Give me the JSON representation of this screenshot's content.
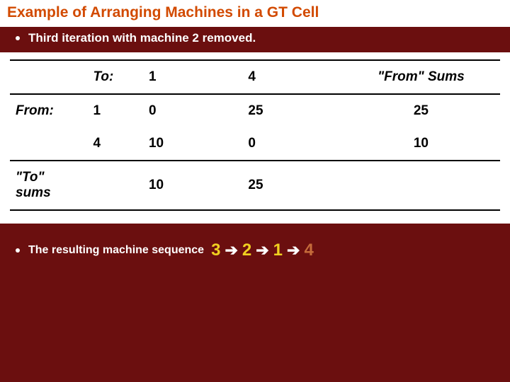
{
  "title": "Example of Arranging Machines in a GT Cell",
  "bullets": {
    "iteration": "Third iteration with machine 2 removed.",
    "result_label": "The resulting machine sequence"
  },
  "table": {
    "to_label": "To:",
    "from_label": "From:",
    "to_sums_label": "\"To\" sums",
    "from_sums_label": "\"From\" Sums",
    "col_headers": [
      "1",
      "4"
    ],
    "row_headers": [
      "1",
      "4"
    ],
    "cells": [
      [
        "0",
        "25"
      ],
      [
        "10",
        "0"
      ]
    ],
    "from_sums": [
      "25",
      "10"
    ],
    "to_sums": [
      "10",
      "25"
    ]
  },
  "sequence": {
    "items": [
      "3",
      "2",
      "1",
      "4"
    ],
    "arrow": "➔"
  },
  "chart_data": {
    "type": "table",
    "title": "From/To chart — third iteration (machine 2 removed)",
    "row_labels": [
      "1",
      "4"
    ],
    "col_labels": [
      "1",
      "4"
    ],
    "matrix": [
      [
        0,
        25
      ],
      [
        10,
        0
      ]
    ],
    "from_sums": [
      25,
      10
    ],
    "to_sums": [
      10,
      25
    ],
    "resulting_sequence": [
      3,
      2,
      1,
      4
    ]
  }
}
